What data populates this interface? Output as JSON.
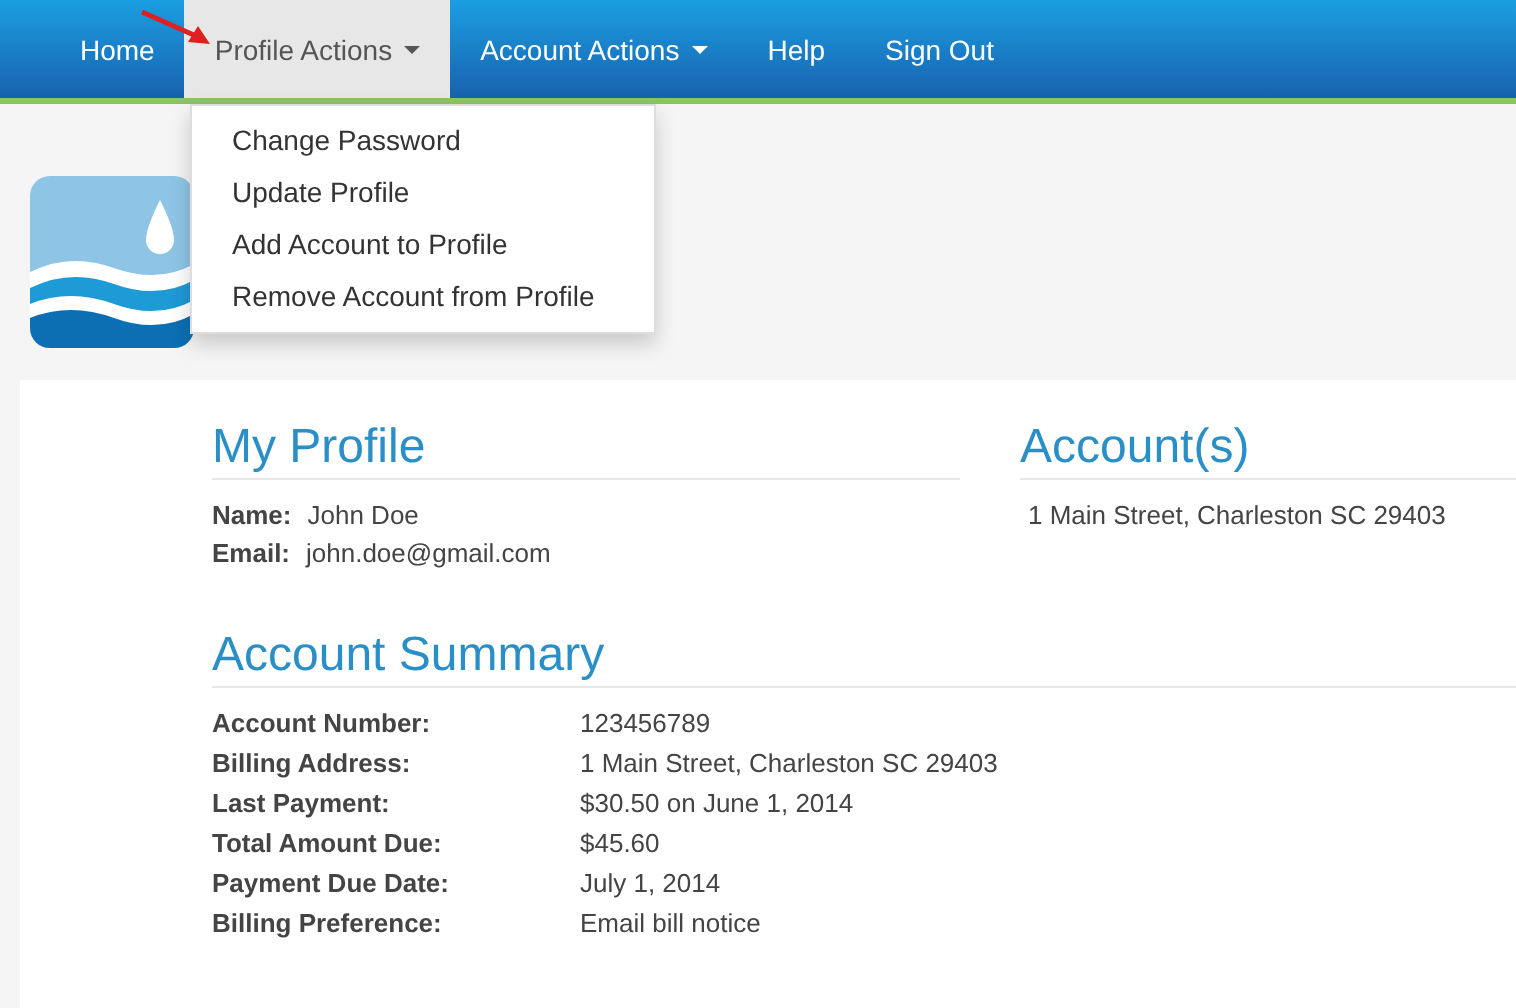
{
  "nav": {
    "items": [
      {
        "label": "Home",
        "selected": false,
        "dropdown": false
      },
      {
        "label": "Profile Actions",
        "selected": true,
        "dropdown": true
      },
      {
        "label": "Account Actions",
        "selected": false,
        "dropdown": true
      },
      {
        "label": "Help",
        "selected": false,
        "dropdown": false
      },
      {
        "label": "Sign Out",
        "selected": false,
        "dropdown": false
      }
    ]
  },
  "dropdown_menu": {
    "items": [
      "Change Password",
      "Update Profile",
      "Add Account to Profile",
      "Remove Account from Profile"
    ]
  },
  "profile": {
    "title": "My Profile",
    "fields": [
      {
        "label": "Name:",
        "value": "John Doe"
      },
      {
        "label": "Email:",
        "value": "john.doe@gmail.com"
      }
    ]
  },
  "accounts": {
    "title": "Account(s)",
    "items": [
      "1 Main Street, Charleston SC 29403"
    ]
  },
  "summary": {
    "title": "Account Summary",
    "rows": [
      {
        "label": "Account Number:",
        "value": "123456789"
      },
      {
        "label": "Billing Address:",
        "value": "1 Main Street, Charleston SC 29403"
      },
      {
        "label": "Last Payment:",
        "value": "$30.50 on June 1, 2014"
      },
      {
        "label": "Total Amount Due:",
        "value": "$45.60"
      },
      {
        "label": "Payment Due Date:",
        "value": "July 1, 2014"
      },
      {
        "label": "Billing Preference:",
        "value": "Email bill notice"
      }
    ]
  }
}
